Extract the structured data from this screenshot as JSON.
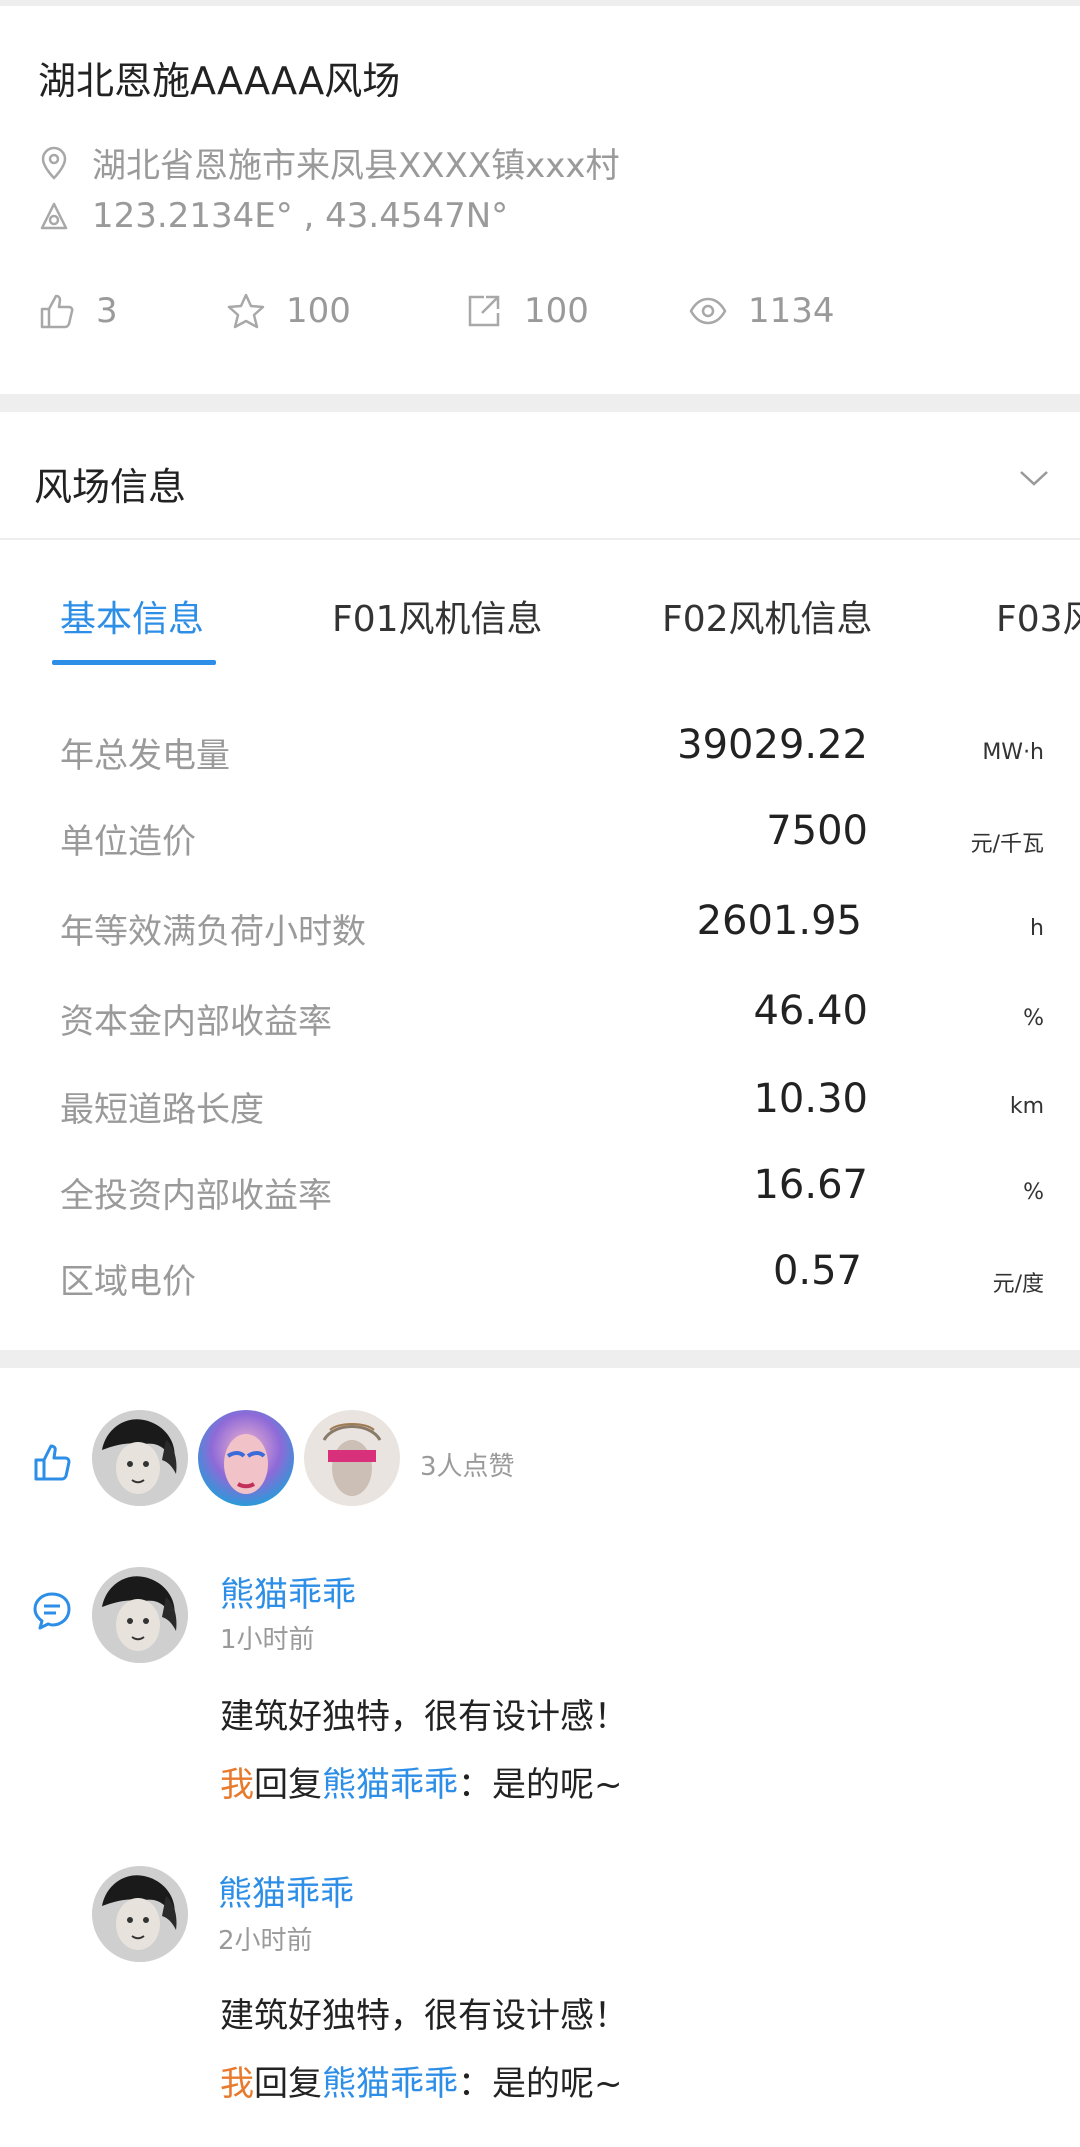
{
  "site": {
    "title": "湖北恩施AAAAA风场",
    "address": "湖北省恩施市来凤县XXXX镇xxx村",
    "coordinates": "123.2134E° , 43.4547N°"
  },
  "stats": {
    "likes": "3",
    "favorites": "100",
    "shares": "100",
    "views": "1134"
  },
  "section": {
    "title": "风场信息"
  },
  "tabs": [
    {
      "label": "基本信息"
    },
    {
      "label": "F01风机信息"
    },
    {
      "label": "F02风机信息"
    },
    {
      "label": "F03风"
    }
  ],
  "info": [
    {
      "label": "年总发电量",
      "value": "39029.22",
      "unit": "MW·h"
    },
    {
      "label": "单位造价",
      "value": "7500",
      "unit": "元/千瓦"
    },
    {
      "label": "年等效满负荷小时数",
      "value": "2601.95",
      "unit": "h"
    },
    {
      "label": "资本金内部收益率",
      "value": "46.40",
      "unit": "%"
    },
    {
      "label": "最短道路长度",
      "value": "10.30",
      "unit": "km"
    },
    {
      "label": "全投资内部收益率",
      "value": "16.67",
      "unit": "%"
    },
    {
      "label": "区域电价",
      "value": "0.57",
      "unit": "元/度"
    }
  ],
  "likes": {
    "text": "3人点赞"
  },
  "comments": [
    {
      "name": "熊猫乖乖",
      "time": "1小时前",
      "text": "建筑好独特，很有设计感！",
      "reply_me": "我",
      "reply_word": "回复",
      "reply_to": "熊猫乖乖",
      "reply_text": "：是的呢~"
    },
    {
      "name": "熊猫乖乖",
      "time": "2小时前",
      "text": "建筑好独特，很有设计感！",
      "reply_me": "我",
      "reply_word": "回复",
      "reply_to": "熊猫乖乖",
      "reply_text": "：是的呢~"
    }
  ],
  "colors": {
    "accent": "#2c8ee6",
    "me": "#e87a2e",
    "muted": "#9a9a9a"
  }
}
